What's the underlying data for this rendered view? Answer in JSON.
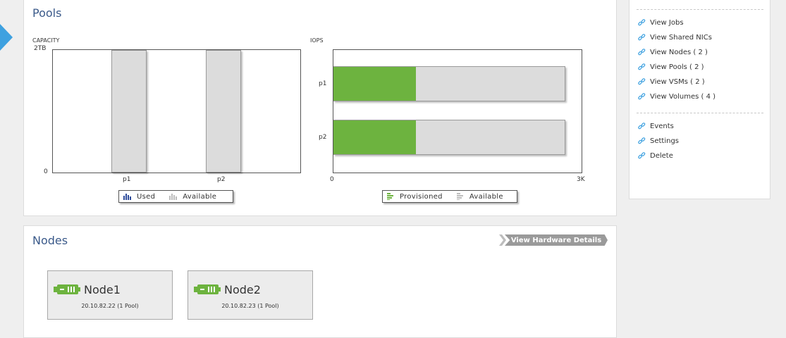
{
  "pools": {
    "title": "Pools",
    "capacity": {
      "label": "CAPACITY",
      "y_max_label": "2TB",
      "y_min_label": "0",
      "categories": [
        "p1",
        "p2"
      ],
      "legend": {
        "used": "Used",
        "available": "Available"
      }
    },
    "iops": {
      "label": "IOPS",
      "x_min_label": "0",
      "x_max_label": "3K",
      "categories": [
        "p1",
        "p2"
      ],
      "legend": {
        "provisioned": "Provisioned",
        "available": "Available"
      }
    }
  },
  "chart_data": [
    {
      "type": "bar",
      "title": "CAPACITY",
      "categories": [
        "p1",
        "p2"
      ],
      "series": [
        {
          "name": "Used",
          "values": [
            0,
            0
          ]
        },
        {
          "name": "Available",
          "values": [
            2,
            2
          ]
        }
      ],
      "ylabel": "",
      "ylim": [
        0,
        2
      ],
      "y_ticks": [
        "0",
        "2TB"
      ],
      "orientation": "vertical"
    },
    {
      "type": "bar",
      "title": "IOPS",
      "categories": [
        "p1",
        "p2"
      ],
      "series": [
        {
          "name": "Provisioned",
          "values": [
            1000,
            1000
          ]
        },
        {
          "name": "Available",
          "values": [
            2800,
            2800
          ]
        }
      ],
      "xlim": [
        0,
        3000
      ],
      "x_ticks": [
        "0",
        "3K"
      ],
      "orientation": "horizontal"
    }
  ],
  "nodes": {
    "title": "Nodes",
    "hardware_button": "View Hardware Details",
    "items": [
      {
        "name": "Node1",
        "info": "20.10.82.22 (1 Pool)"
      },
      {
        "name": "Node2",
        "info": "20.10.82.23 (1 Pool)"
      }
    ]
  },
  "sidebar": {
    "links": [
      "View Jobs",
      "View Shared NICs",
      "View Nodes ( 2 )",
      "View Pools ( 2 )",
      "View VSMs ( 2 )",
      "View Volumes ( 4 )"
    ],
    "actions": [
      "Events",
      "Settings",
      "Delete"
    ]
  },
  "colors": {
    "accent_blue": "#3ea1e0",
    "title_blue": "#3b5a8a",
    "provisioned_green": "#6db33f",
    "available_gray": "#dcdcdc",
    "used_blue": "#2c4a9a"
  },
  "icons": {
    "link": "link-icon",
    "node": "server-icon"
  }
}
